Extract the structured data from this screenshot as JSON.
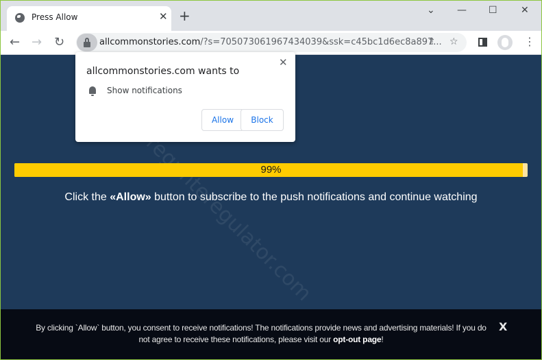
{
  "browser": {
    "tab": {
      "title": "Press Allow",
      "favicon": "globe-icon",
      "close_icon": "✕"
    },
    "new_tab_icon": "+",
    "window_controls": {
      "tab_search": "⌄",
      "minimize": "—",
      "maximize": "☐",
      "close": "✕"
    },
    "nav": {
      "back": "←",
      "forward": "→",
      "reload": "↻"
    },
    "address": {
      "host": "allcommonstories.com",
      "rest": "/?s=705073061967434039&ssk=c45bc1d6ec8a897..."
    },
    "share_icon": "⇪",
    "bookmark_icon": "☆",
    "menu_icon": "⋮"
  },
  "permission_popup": {
    "title": "allcommonstories.com wants to",
    "permission": "Show notifications",
    "allow_label": "Allow",
    "block_label": "Block",
    "close_icon": "✕"
  },
  "page": {
    "progress": {
      "percent": 99,
      "label": "99%"
    },
    "cta": {
      "before": "Click the ",
      "emphasis": "«Allow»",
      "after": " button to subscribe to the push notifications and continue watching"
    },
    "footer": {
      "text": "By clicking `Allow` button, you consent to receive notifications! The notifications provide news and advertising materials! If you do not agree to receive these notifications, please visit our ",
      "link": "opt-out page",
      "suffix": "!",
      "close_icon": "X"
    },
    "watermark": "regunteregulator.com"
  },
  "colors": {
    "page_bg": "#1e3a5a",
    "progress_fill": "#ffcc00",
    "footer_bg": "#070b14",
    "button_text": "#1a73e8"
  }
}
